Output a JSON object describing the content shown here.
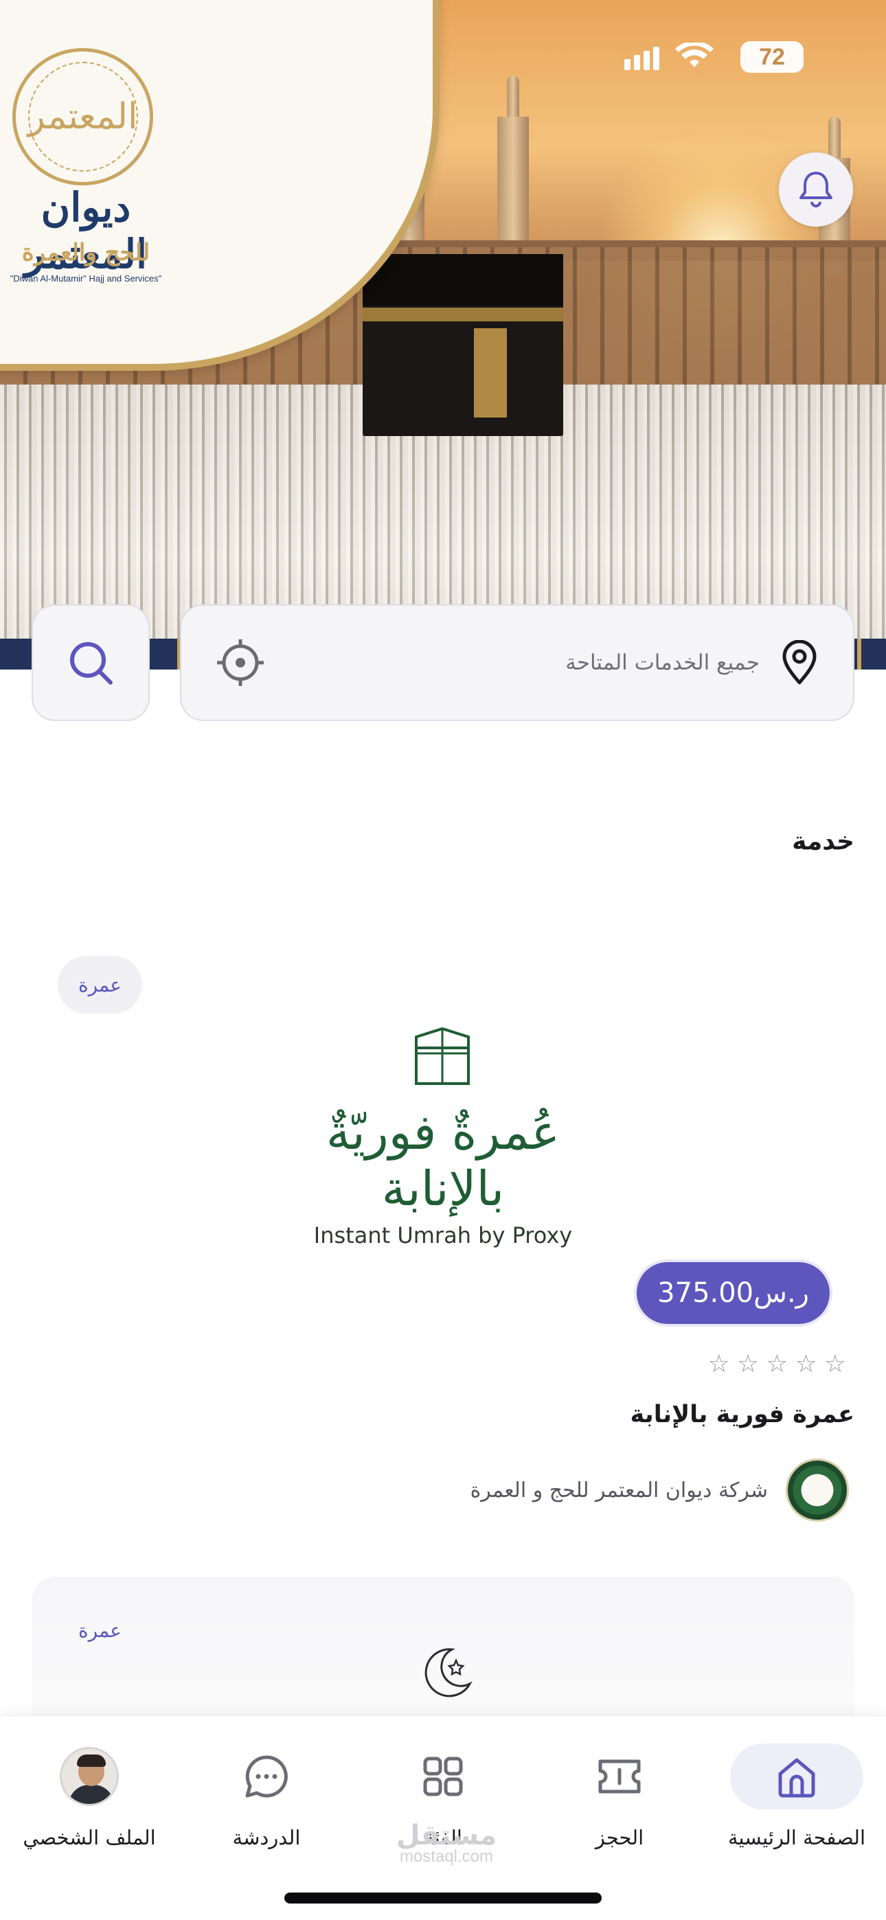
{
  "status_bar": {
    "battery": "72"
  },
  "brand": {
    "seal_text": "المعتمر",
    "name_ar": "ديوان المعتمر",
    "tagline_ar": "للحج والعمرة",
    "name_en": "\"Diwan Al-Mutamir\" Hajj and Services\""
  },
  "search": {
    "placeholder": "جميع الخدمات المتاحة"
  },
  "section": {
    "title": "خدمة"
  },
  "services": [
    {
      "tag": "عمرة",
      "logo_ar": "عُمرةٌ فوريّةٌ بالإنابة",
      "logo_en": "Instant Umrah by Proxy",
      "price": "ر.س375.00",
      "rating": 0,
      "stars": "☆☆☆☆☆",
      "title": "عمرة فورية بالإنابة",
      "vendor": "شركة ديوان المعتمر للحج و العمرة"
    },
    {
      "tag": "عمرة"
    }
  ],
  "tabbar": {
    "items": [
      {
        "label": "الصفحة الرئيسية",
        "icon": "home-icon",
        "active": true
      },
      {
        "label": "الحجز",
        "icon": "ticket-icon",
        "active": false
      },
      {
        "label": "الفئة",
        "icon": "grid-icon",
        "active": false
      },
      {
        "label": "الدردشة",
        "icon": "chat-icon",
        "active": false
      },
      {
        "label": "الملف الشخصي",
        "icon": "avatar",
        "active": false
      }
    ]
  },
  "watermark": {
    "ar": "مستقل",
    "en": "mostaql.com"
  },
  "colors": {
    "accent": "#5c56bd",
    "gold": "#c9a561",
    "navy": "#1f3b6a",
    "green": "#1f5d35"
  }
}
